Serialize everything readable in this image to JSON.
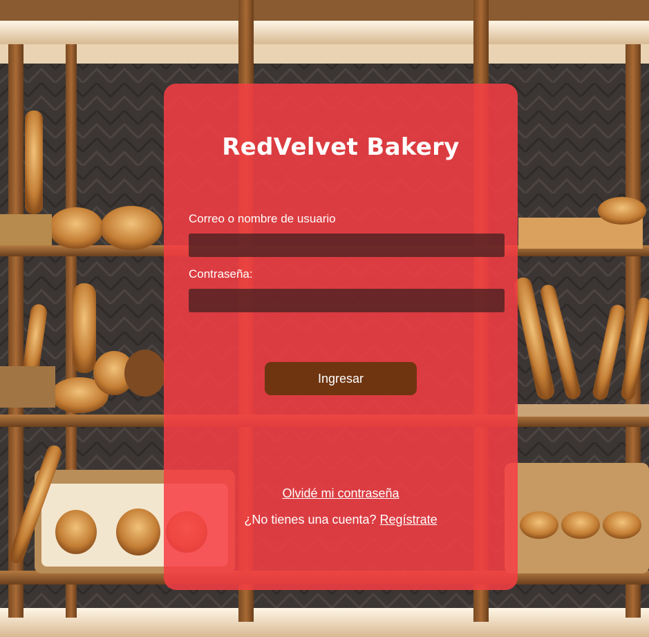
{
  "app": {
    "title": "RedVelvet Bakery"
  },
  "login_form": {
    "username_label": "Correo o nombre de usuario",
    "username_value": "",
    "username_placeholder": "",
    "password_label": "Contraseña:",
    "password_value": "",
    "password_placeholder": "",
    "submit_label": "Ingresar",
    "forgot_password_link": "Olvidé mi contraseña",
    "no_account_text": "¿No tienes una cuenta?",
    "register_link": "Regístrate"
  },
  "colors": {
    "card_background": "#f63e44",
    "button_background": "#6e3510",
    "text": "#ffffff"
  },
  "background": {
    "icon": "bakery-shelves-photo"
  }
}
